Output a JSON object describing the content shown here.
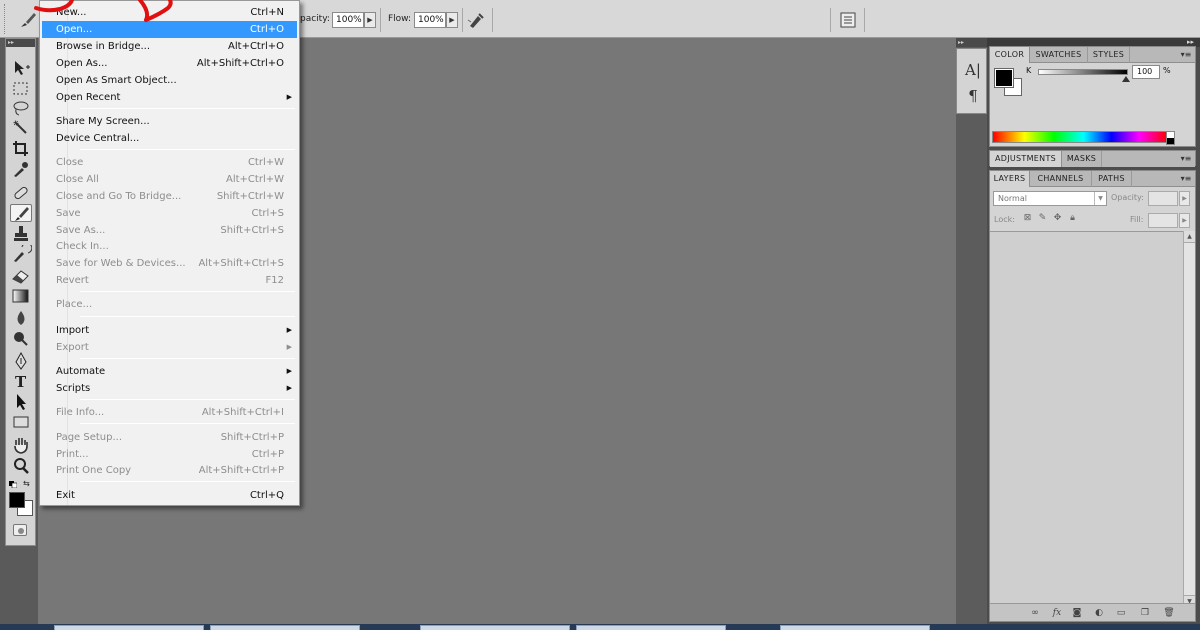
{
  "options_bar": {
    "opacity_label": "pacity:",
    "opacity_value": "100%",
    "flow_label": "Flow:",
    "flow_value": "100%",
    "icons": [
      "brush-tool-icon",
      "airbrush-icon",
      "brush-panel-icon"
    ]
  },
  "file_menu": {
    "items": [
      {
        "label": "New...",
        "shortcut": "Ctrl+N",
        "enabled": true
      },
      {
        "label": "Open...",
        "shortcut": "Ctrl+O",
        "enabled": true,
        "highlighted": true
      },
      {
        "label": "Browse in Bridge...",
        "shortcut": "Alt+Ctrl+O",
        "enabled": true
      },
      {
        "label": "Open As...",
        "shortcut": "Alt+Shift+Ctrl+O",
        "enabled": true
      },
      {
        "label": "Open As Smart Object...",
        "shortcut": "",
        "enabled": true
      },
      {
        "label": "Open Recent",
        "shortcut": "",
        "enabled": true,
        "submenu": true
      },
      {
        "label": "Share My Screen...",
        "shortcut": "",
        "enabled": true
      },
      {
        "label": "Device Central...",
        "shortcut": "",
        "enabled": true
      },
      {
        "label": "Close",
        "shortcut": "Ctrl+W",
        "enabled": false
      },
      {
        "label": "Close All",
        "shortcut": "Alt+Ctrl+W",
        "enabled": false
      },
      {
        "label": "Close and Go To Bridge...",
        "shortcut": "Shift+Ctrl+W",
        "enabled": false
      },
      {
        "label": "Save",
        "shortcut": "Ctrl+S",
        "enabled": false
      },
      {
        "label": "Save As...",
        "shortcut": "Shift+Ctrl+S",
        "enabled": false
      },
      {
        "label": "Check In...",
        "shortcut": "",
        "enabled": false
      },
      {
        "label": "Save for Web & Devices...",
        "shortcut": "Alt+Shift+Ctrl+S",
        "enabled": false
      },
      {
        "label": "Revert",
        "shortcut": "F12",
        "enabled": false
      },
      {
        "label": "Place...",
        "shortcut": "",
        "enabled": false
      },
      {
        "label": "Import",
        "shortcut": "",
        "enabled": true,
        "submenu": true
      },
      {
        "label": "Export",
        "shortcut": "",
        "enabled": false,
        "submenu": true
      },
      {
        "label": "Automate",
        "shortcut": "",
        "enabled": true,
        "submenu": true
      },
      {
        "label": "Scripts",
        "shortcut": "",
        "enabled": true,
        "submenu": true
      },
      {
        "label": "File Info...",
        "shortcut": "Alt+Shift+Ctrl+I",
        "enabled": false
      },
      {
        "label": "Page Setup...",
        "shortcut": "Shift+Ctrl+P",
        "enabled": false
      },
      {
        "label": "Print...",
        "shortcut": "Ctrl+P",
        "enabled": false
      },
      {
        "label": "Print One Copy",
        "shortcut": "Alt+Shift+Ctrl+P",
        "enabled": false
      },
      {
        "label": "Exit",
        "shortcut": "Ctrl+Q",
        "enabled": true
      }
    ],
    "submenu_arrow": "▶"
  },
  "tools": [
    "move-tool-icon",
    "marquee-tool-icon",
    "lasso-tool-icon",
    "quick-selection-tool-icon",
    "crop-tool-icon",
    "eyedropper-tool-icon",
    "healing-brush-tool-icon",
    "brush-tool-icon",
    "clone-stamp-tool-icon",
    "history-brush-tool-icon",
    "eraser-tool-icon",
    "gradient-tool-icon",
    "blur-tool-icon",
    "dodge-tool-icon",
    "pen-tool-icon",
    "type-tool-icon",
    "path-selection-tool-icon",
    "shape-tool-icon",
    "hand-tool-icon",
    "zoom-tool-icon"
  ],
  "dock": {
    "character_icon": "A|",
    "paragraph_icon": "¶"
  },
  "color_panel": {
    "tabs": [
      "COLOR",
      "SWATCHES",
      "STYLES"
    ],
    "channel_label": "K",
    "channel_value": "100",
    "unit": "%",
    "foreground_color": "#000000",
    "background_color": "#ffffff"
  },
  "adjustments_panel": {
    "tabs": [
      "ADJUSTMENTS",
      "MASKS"
    ]
  },
  "layers_panel": {
    "tabs": [
      "LAYERS",
      "CHANNELS",
      "PATHS"
    ],
    "blend_mode": "Normal",
    "opacity_label": "Opacity:",
    "lock_label": "Lock:",
    "fill_label": "Fill:"
  },
  "colors": {
    "menu_highlight": "#3399ff",
    "workspace": "#777777",
    "panel": "#d4d4d4",
    "annotation": "#e01010"
  }
}
